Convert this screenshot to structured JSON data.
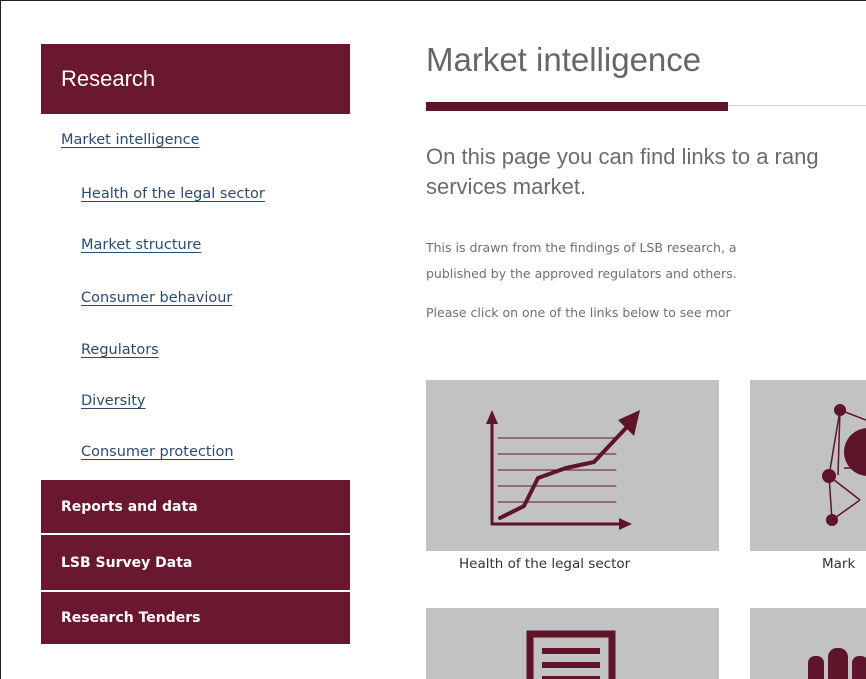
{
  "sidebar": {
    "header": "Research",
    "links": [
      "Market intelligence",
      "Health of the legal sector",
      "Market structure",
      "Consumer behaviour",
      "Regulators",
      "Diversity",
      "Consumer protection"
    ],
    "sections": [
      "Reports and data",
      "LSB Survey Data",
      "Research Tenders"
    ]
  },
  "main": {
    "title": "Market intelligence",
    "lead": "On this page you can find links to a rang\nservices market.",
    "body1": "This is drawn from the findings of LSB research, a",
    "body2": "published by the approved regulators and others.",
    "body3": "Please click on one of the links below to see mor",
    "tiles": [
      {
        "caption": "Health of the legal sector",
        "icon": "line-chart-icon"
      },
      {
        "caption": "Mark",
        "icon": "network-icon"
      },
      {
        "caption": "",
        "icon": "document-icon"
      },
      {
        "caption": "",
        "icon": "people-icon"
      }
    ]
  },
  "colors": {
    "brand": "#6a1730",
    "tile": "#c2c2c2",
    "link": "#2b4b6e"
  }
}
